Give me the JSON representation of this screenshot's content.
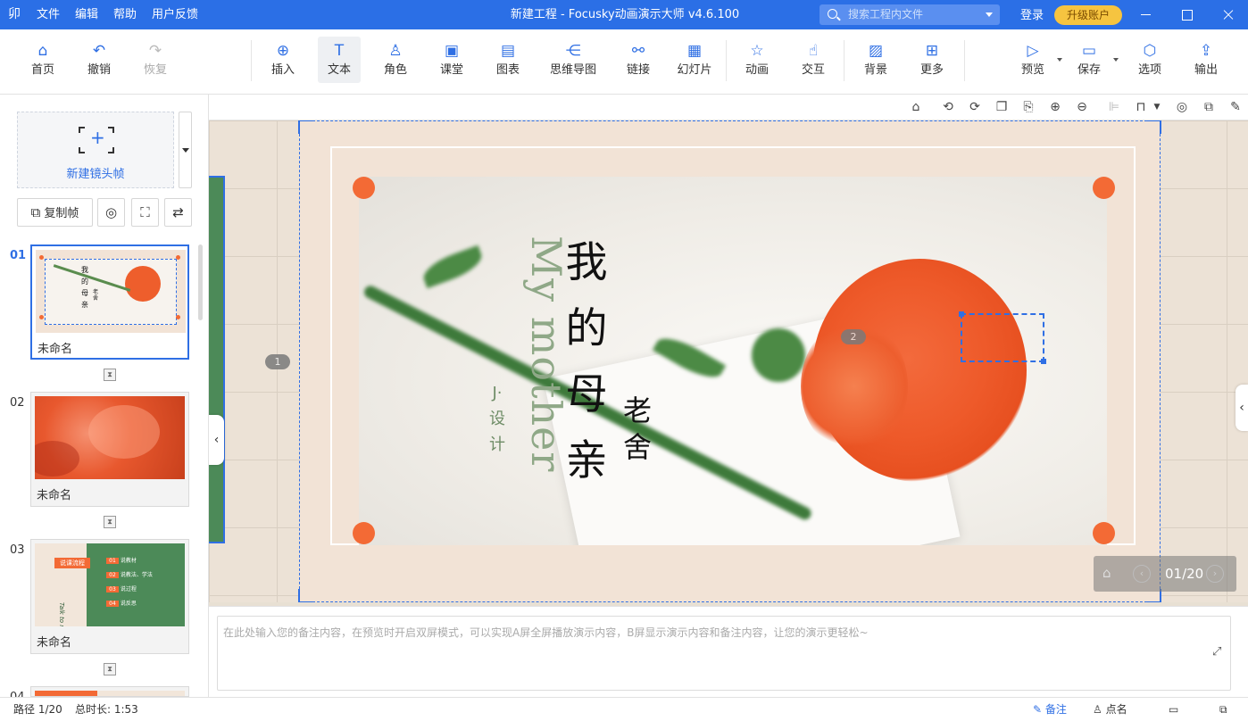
{
  "titlebar": {
    "logo": "卯",
    "menu": [
      "文件",
      "编辑",
      "帮助",
      "用户反馈"
    ],
    "title": "新建工程 - Focusky动画演示大师  v4.6.100",
    "search_placeholder": "搜索工程内文件",
    "login": "登录",
    "upgrade": "升级账户",
    "accent_color": "#2b6fe6"
  },
  "toolbar": {
    "home": "首页",
    "undo": "撤销",
    "redo": "恢复",
    "insert": "插入",
    "text": "文本",
    "role": "角色",
    "classroom": "课堂",
    "chart": "图表",
    "mindmap": "思维导图",
    "link": "链接",
    "slideshow": "幻灯片",
    "animation": "动画",
    "interaction": "交互",
    "background": "背景",
    "more": "更多",
    "preview": "预览",
    "save": "保存",
    "options": "选项",
    "export": "输出"
  },
  "sidebar": {
    "new_frame": "新建镜头帧",
    "copy_frame": "复制帧",
    "frames": [
      {
        "num": "01",
        "name": "未命名"
      },
      {
        "num": "02",
        "name": "未命名"
      },
      {
        "num": "03",
        "name": "未命名"
      },
      {
        "num": "04",
        "name": ""
      }
    ],
    "thumb3": {
      "badge": "说课流程",
      "side": "Talk to me",
      "items": [
        {
          "n": "01",
          "t": "说教材"
        },
        {
          "n": "02",
          "t": "说教法、学法"
        },
        {
          "n": "03",
          "t": "说过程"
        },
        {
          "n": "04",
          "t": "说反思"
        }
      ]
    },
    "thumb1": {
      "title": [
        "我",
        "的",
        "母",
        "亲"
      ],
      "sub": [
        "老",
        "舍"
      ]
    }
  },
  "slide": {
    "title_chars": [
      "我",
      "的",
      "母",
      "亲"
    ],
    "author_chars": [
      "老",
      "舍"
    ],
    "english": "My mother",
    "design_chars": [
      "J·",
      "设",
      "计"
    ],
    "pin1": "1",
    "pin2": "2",
    "pager": {
      "current": "01/20"
    },
    "accent_dot_color": "#f36a35"
  },
  "notes": {
    "placeholder": "在此处输入您的备注内容，在预览时开启双屏模式，可以实现A屏全屏播放演示内容，B屏显示演示内容和备注内容，让您的演示更轻松~"
  },
  "status": {
    "path": "路径 1/20",
    "duration": "总时长: 1:53",
    "notes_btn": "备注",
    "rollcall": "点名"
  }
}
